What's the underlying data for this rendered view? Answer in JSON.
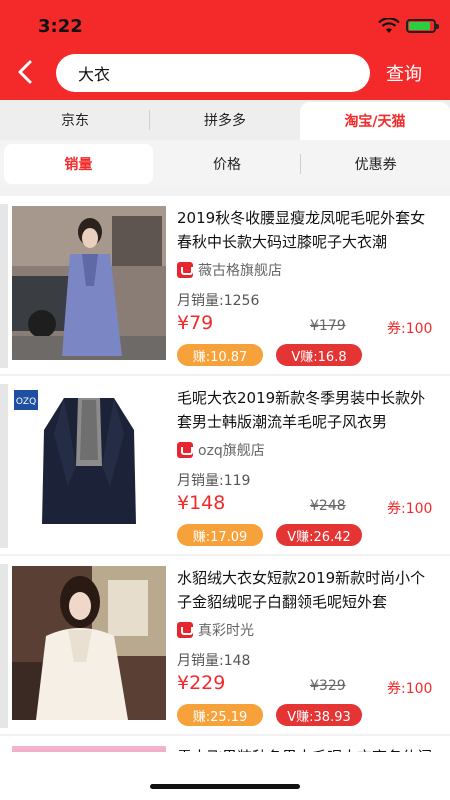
{
  "status": {
    "time": "3:22"
  },
  "search": {
    "query": "大衣",
    "button_label": "查询"
  },
  "platform_tabs": [
    {
      "label": "京东",
      "active": false
    },
    {
      "label": "拼多多",
      "active": false
    },
    {
      "label": "淘宝/天猫",
      "active": true
    }
  ],
  "sort_tabs": [
    {
      "label": "销量",
      "active": true
    },
    {
      "label": "价格",
      "active": false
    },
    {
      "label": "优惠券",
      "active": false
    }
  ],
  "products": [
    {
      "title": "2019秋冬收腰显瘦龙凤呢毛呢外套女春秋中长款大码过膝呢子大衣潮",
      "shop": "薇古格旗舰店",
      "sales": "月销量:1256",
      "price": "¥79",
      "original_price": "¥179",
      "coupon": "券:100",
      "earn": "赚:10.87",
      "v_earn": "V赚:16.8"
    },
    {
      "title": "毛呢大衣2019新款冬季男装中长款外套男士韩版潮流羊毛呢子风衣男",
      "shop": "ozq旗舰店",
      "sales": "月销量:119",
      "price": "¥148",
      "original_price": "¥248",
      "coupon": "券:100",
      "earn": "赚:17.09",
      "v_earn": "V赚:26.42",
      "thumb_logo": "OZQ"
    },
    {
      "title": "水貂绒大衣女短款2019新款时尚小个子金貂绒呢子白翻领毛呢短外套",
      "shop": "真彩时光",
      "sales": "月销量:148",
      "price": "¥229",
      "original_price": "¥329",
      "coupon": "券:100",
      "earn": "赚:25.19",
      "v_earn": "V赚:38.93"
    }
  ],
  "partial_product": {
    "title": "雪中飞男装秋冬男士毛呢大衣商务休闲"
  },
  "colors": {
    "accent": "#f42a2a",
    "earn": "#f7a13a",
    "v_earn": "#e53434"
  }
}
